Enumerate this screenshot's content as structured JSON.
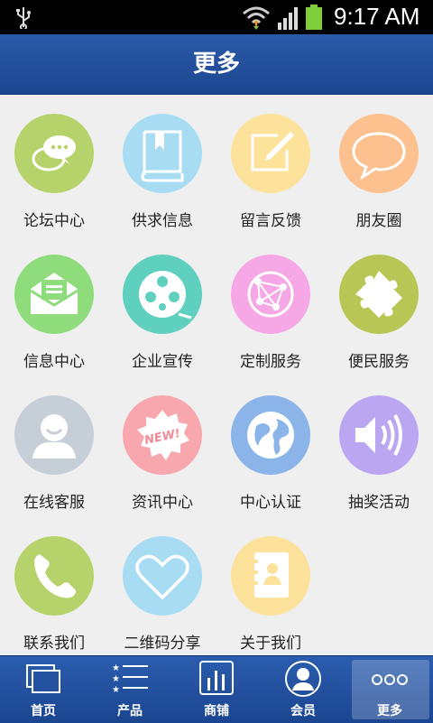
{
  "status_bar": {
    "time": "9:17 AM"
  },
  "header": {
    "title": "更多"
  },
  "items": [
    {
      "label": "论坛中心",
      "icon": "chat-icon",
      "color": "#b6d36b"
    },
    {
      "label": "供求信息",
      "icon": "book-icon",
      "color": "#a7dcf3"
    },
    {
      "label": "留言反馈",
      "icon": "edit-note-icon",
      "color": "#fce29a"
    },
    {
      "label": "朋友圈",
      "icon": "speech-bubble-icon",
      "color": "#fdc18f"
    },
    {
      "label": "信息中心",
      "icon": "envelope-icon",
      "color": "#8fdc7c"
    },
    {
      "label": "企业宣传",
      "icon": "film-reel-icon",
      "color": "#5fcfbe"
    },
    {
      "label": "定制服务",
      "icon": "network-globe-icon",
      "color": "#f6a7e6"
    },
    {
      "label": "便民服务",
      "icon": "puzzle-icon",
      "color": "#b7c655"
    },
    {
      "label": "在线客服",
      "icon": "user-support-icon",
      "color": "#c6ced8"
    },
    {
      "label": "资讯中心",
      "icon": "new-badge-icon",
      "color": "#f7a7ad"
    },
    {
      "label": "中心认证",
      "icon": "globe-icon",
      "color": "#8bb4e8"
    },
    {
      "label": "抽奖活动",
      "icon": "speaker-icon",
      "color": "#bba7f1"
    },
    {
      "label": "联系我们",
      "icon": "phone-icon",
      "color": "#b6d36b"
    },
    {
      "label": "二维码分享",
      "icon": "heart-icon",
      "color": "#a7dcf3"
    },
    {
      "label": "关于我们",
      "icon": "contacts-book-icon",
      "color": "#fce29a"
    }
  ],
  "tabs": [
    {
      "label": "首页",
      "icon": "home-windows-icon",
      "active": false
    },
    {
      "label": "产品",
      "icon": "list-stars-icon",
      "active": false
    },
    {
      "label": "商铺",
      "icon": "shop-chart-icon",
      "active": false
    },
    {
      "label": "会员",
      "icon": "member-avatar-icon",
      "active": false
    },
    {
      "label": "更多",
      "icon": "more-dots-icon",
      "active": true
    }
  ]
}
